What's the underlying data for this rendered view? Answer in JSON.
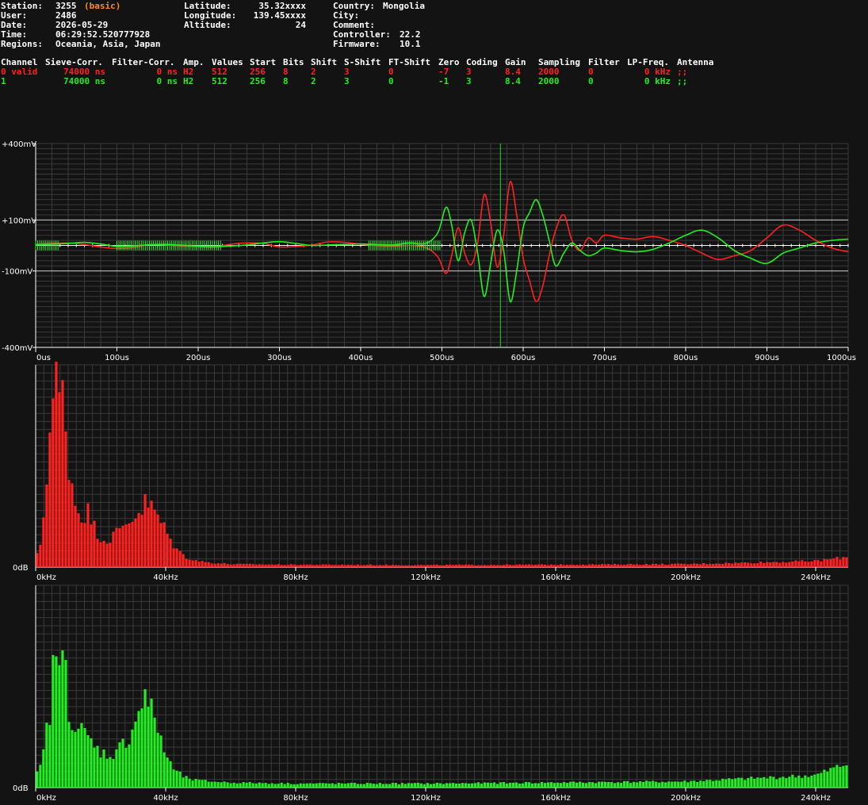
{
  "header": {
    "station_label": "Station:",
    "station_value": "3255",
    "station_tag": "(basic)",
    "user_label": "User:",
    "user_value": "2486",
    "date_label": "Date:",
    "date_value": "2026-05-29",
    "time_label": "Time:",
    "time_value": "06:29:52.520777928",
    "regions_label": "Regions:",
    "regions_value": "Oceania, Asia, Japan",
    "latitude_label": "Latitude:",
    "latitude_value": "35.32xxxx",
    "longitude_label": "Longitude:",
    "longitude_value": "139.45xxxx",
    "altitude_label": "Altitude:",
    "altitude_value": "24",
    "country_label": "Country:",
    "country_value": "Mongolia",
    "city_label": "City:",
    "city_value": "",
    "comment_label": "Comment:",
    "comment_value": "",
    "controller_label": "Controller:",
    "controller_value": "22.2",
    "firmware_label": "Firmware:",
    "firmware_value": "10.1"
  },
  "channels": {
    "headers": [
      "Channel",
      "Sieve-Corr.",
      "Filter-Corr.",
      "Amp.",
      "Values",
      "Start",
      "Bits",
      "Shift",
      "S-Shift",
      "FT-Shift",
      "Zero",
      "Coding",
      "Gain",
      "Sampling",
      "Filter",
      "LP-Freq.",
      "Antenna"
    ],
    "rows": [
      {
        "color": "#ff2020",
        "cells": [
          "0 valid",
          "74000 ns",
          "0 ns",
          "H2",
          "512",
          "256",
          "8",
          "2",
          "3",
          "0",
          "-7",
          "3",
          "8.4",
          "2000",
          "0",
          "0 kHz",
          ";;"
        ]
      },
      {
        "color": "#22ee22",
        "cells": [
          "1",
          "74000 ns",
          "0 ns",
          "H2",
          "512",
          "256",
          "8",
          "2",
          "3",
          "0",
          "-1",
          "3",
          "8.4",
          "2000",
          "0",
          "0 kHz",
          ";;"
        ]
      }
    ]
  },
  "colors": {
    "background": "#131313",
    "channel0": "#ff2020",
    "channel1": "#22ee22",
    "tag": "#ff8c1a",
    "grid": "#3a3a3a",
    "axis": "#ffffff"
  },
  "chart_data": [
    {
      "type": "line",
      "name": "waveform",
      "xlim": [
        0,
        1000
      ],
      "ylim": [
        -400,
        400
      ],
      "x_ticks": [
        "0us",
        "100us",
        "200us",
        "300us",
        "400us",
        "500us",
        "600us",
        "700us",
        "800us",
        "900us",
        "1000us"
      ],
      "y_ticks": [
        "+400mV",
        "+100mV",
        "-100mV",
        "-400mV"
      ],
      "y_tick_values": [
        400,
        100,
        -100,
        -400
      ],
      "marker_x": 572,
      "series": [
        {
          "color": "#ff2020",
          "x": [
            0,
            20,
            40,
            60,
            80,
            100,
            120,
            140,
            160,
            180,
            200,
            220,
            240,
            260,
            280,
            300,
            320,
            340,
            360,
            380,
            400,
            420,
            440,
            460,
            480,
            495,
            505,
            512,
            520,
            528,
            536,
            544,
            552,
            560,
            568,
            576,
            584,
            592,
            600,
            608,
            616,
            624,
            632,
            640,
            650,
            660,
            670,
            680,
            690,
            700,
            720,
            740,
            760,
            780,
            800,
            820,
            840,
            860,
            880,
            900,
            920,
            940,
            960,
            980,
            1000
          ],
          "values": [
            5,
            8,
            10,
            4,
            -6,
            -12,
            -8,
            3,
            2,
            -2,
            -4,
            -6,
            5,
            10,
            8,
            -6,
            -4,
            2,
            14,
            12,
            5,
            -1,
            -3,
            0,
            -8,
            -45,
            -110,
            -40,
            70,
            -30,
            -75,
            10,
            200,
            90,
            -85,
            40,
            250,
            120,
            -50,
            -140,
            -220,
            -160,
            -40,
            60,
            120,
            20,
            -20,
            30,
            10,
            40,
            30,
            25,
            35,
            20,
            0,
            -30,
            -55,
            -40,
            -20,
            30,
            80,
            60,
            20,
            -10,
            -25
          ]
        },
        {
          "color": "#22ee22",
          "x": [
            0,
            20,
            40,
            60,
            80,
            100,
            120,
            140,
            160,
            180,
            200,
            220,
            240,
            260,
            280,
            300,
            320,
            340,
            360,
            380,
            400,
            420,
            440,
            460,
            480,
            495,
            505,
            512,
            520,
            528,
            536,
            544,
            552,
            560,
            568,
            576,
            584,
            592,
            600,
            608,
            616,
            624,
            632,
            640,
            650,
            660,
            670,
            680,
            690,
            700,
            720,
            740,
            760,
            780,
            800,
            820,
            840,
            860,
            880,
            900,
            920,
            940,
            960,
            980,
            1000
          ],
          "values": [
            2,
            5,
            8,
            12,
            6,
            -4,
            -2,
            3,
            4,
            1,
            -3,
            -5,
            -2,
            2,
            10,
            15,
            8,
            0,
            2,
            4,
            6,
            3,
            2,
            10,
            8,
            50,
            150,
            80,
            -60,
            50,
            100,
            -30,
            -200,
            -70,
            60,
            -20,
            -220,
            -100,
            70,
            130,
            180,
            120,
            20,
            -80,
            -30,
            10,
            -20,
            -40,
            -30,
            -10,
            -20,
            -25,
            -15,
            10,
            40,
            60,
            30,
            -20,
            -50,
            -70,
            -30,
            -10,
            10,
            20,
            25
          ]
        }
      ]
    },
    {
      "type": "bar",
      "name": "spectrum-channel-0",
      "color": "#ff2020",
      "xlim": [
        0,
        250
      ],
      "x_ticks": [
        "0kHz",
        "40kHz",
        "80kHz",
        "120kHz",
        "160kHz",
        "200kHz",
        "240kHz"
      ],
      "y_ticks": [
        "0dB"
      ],
      "knots_x": [
        0,
        2,
        4,
        5,
        6,
        7,
        8,
        9,
        10,
        12,
        14,
        16,
        18,
        20,
        22,
        24,
        26,
        28,
        30,
        32,
        34,
        36,
        38,
        40,
        42,
        44,
        46,
        48,
        50,
        55,
        60,
        80,
        120,
        160,
        200,
        240,
        250
      ],
      "knots_v": [
        0.03,
        0.15,
        0.62,
        0.75,
        0.95,
        0.82,
        0.88,
        0.75,
        0.55,
        0.33,
        0.25,
        0.28,
        0.2,
        0.15,
        0.13,
        0.16,
        0.18,
        0.22,
        0.25,
        0.28,
        0.32,
        0.29,
        0.24,
        0.18,
        0.12,
        0.08,
        0.05,
        0.04,
        0.03,
        0.02,
        0.015,
        0.012,
        0.01,
        0.012,
        0.015,
        0.03,
        0.05
      ]
    },
    {
      "type": "bar",
      "name": "spectrum-channel-1",
      "color": "#22ee22",
      "xlim": [
        0,
        250
      ],
      "x_ticks": [
        "0kHz",
        "40kHz",
        "80kHz",
        "120kHz",
        "160kHz",
        "200kHz",
        "240kHz"
      ],
      "y_ticks": [
        "0dB"
      ],
      "knots_x": [
        0,
        2,
        4,
        5,
        6,
        7,
        8,
        9,
        10,
        12,
        14,
        16,
        18,
        20,
        22,
        24,
        26,
        28,
        30,
        32,
        34,
        36,
        38,
        40,
        42,
        44,
        46,
        48,
        50,
        55,
        60,
        80,
        120,
        160,
        200,
        240,
        250
      ],
      "knots_v": [
        0.05,
        0.12,
        0.35,
        0.42,
        0.8,
        0.58,
        0.55,
        0.68,
        0.42,
        0.3,
        0.28,
        0.25,
        0.2,
        0.18,
        0.16,
        0.17,
        0.2,
        0.23,
        0.3,
        0.4,
        0.45,
        0.36,
        0.28,
        0.16,
        0.1,
        0.07,
        0.05,
        0.04,
        0.035,
        0.03,
        0.025,
        0.02,
        0.02,
        0.025,
        0.03,
        0.06,
        0.12
      ]
    }
  ]
}
